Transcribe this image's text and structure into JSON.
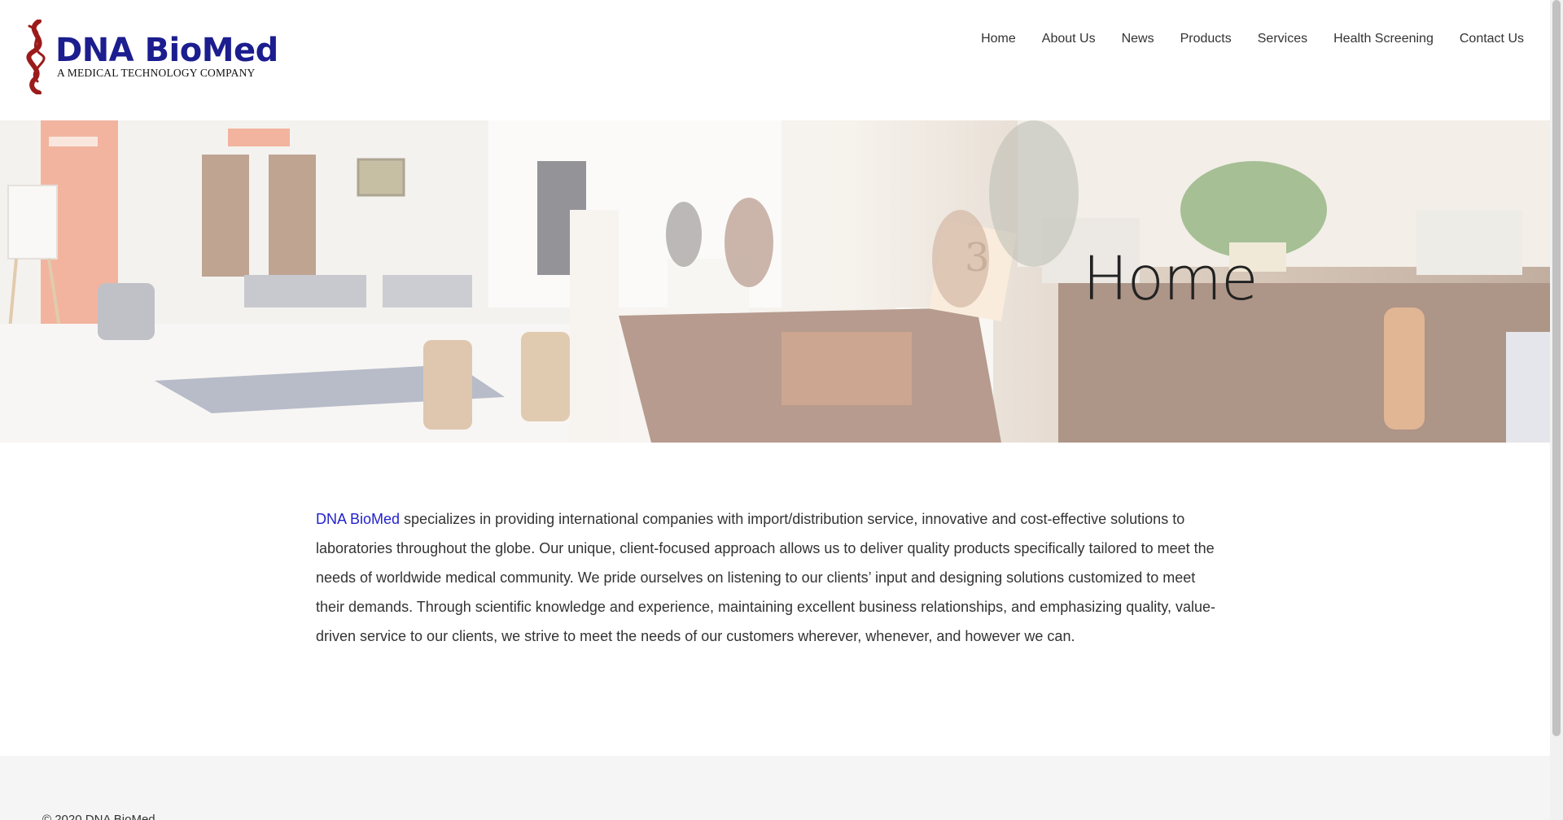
{
  "header": {
    "logo_name": "DNA BioMed",
    "logo_tagline": "A MEDICAL TECHNOLOGY COMPANY",
    "nav": [
      "Home",
      "About Us",
      "News",
      "Products",
      "Services",
      "Health Screening",
      "Contact Us"
    ]
  },
  "hero": {
    "title": "Home",
    "desk_number": "3"
  },
  "intro": {
    "brand_link": "DNA BioMed",
    "text": " specializes in providing international companies with import/distribution service, innovative and cost-effective solutions to laboratories throughout the globe. Our unique, client-focused approach allows us to deliver quality products specifically tailored to meet the needs of worldwide medical community. We pride ourselves on listening to our clients’ input and designing solutions customized to meet their demands. Through scientific knowledge and experience, maintaining excellent business relationships, and emphasizing quality, value-driven service to our clients, we strive to meet the needs of our customers wherever, whenever, and however we can."
  },
  "footer": {
    "copyright": "© 2020 DNA BioMed"
  },
  "colors": {
    "brand_blue": "#1c1d8f",
    "brand_red": "#9b1b1b",
    "link_blue": "#2222cc"
  }
}
